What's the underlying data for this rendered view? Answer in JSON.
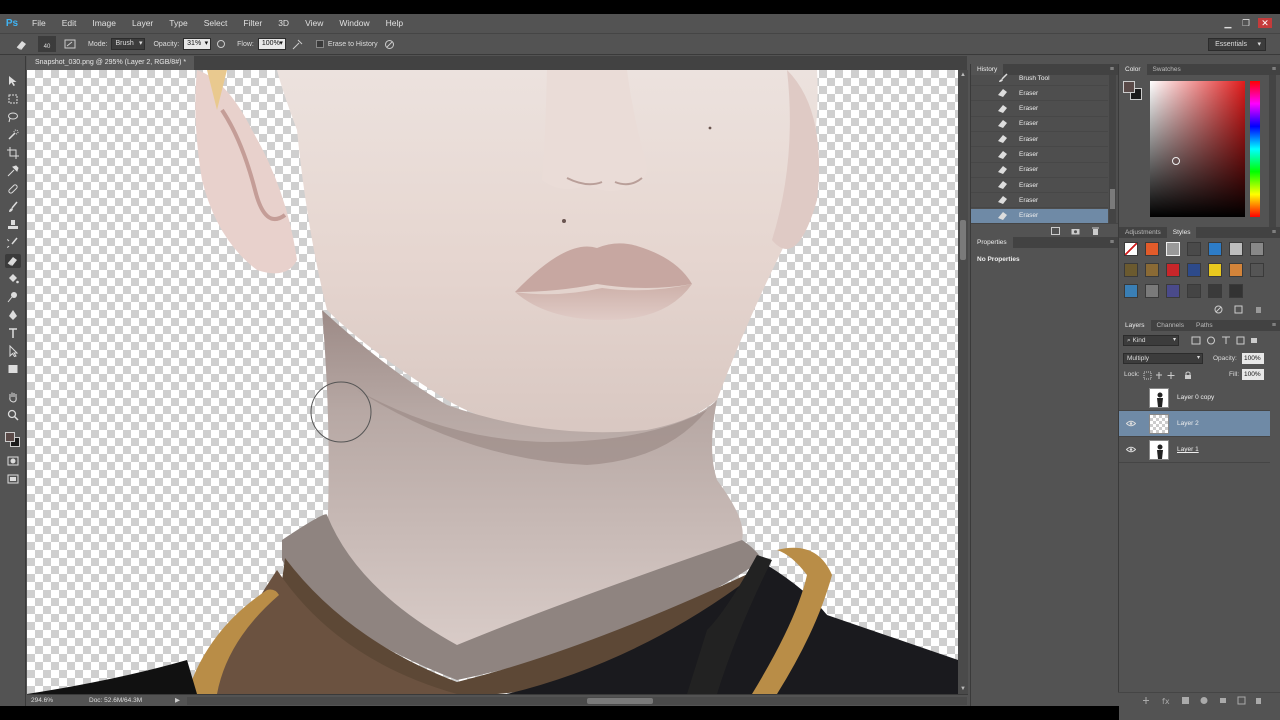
{
  "app": {
    "logo": "Ps",
    "menus": [
      "File",
      "Edit",
      "Image",
      "Layer",
      "Type",
      "Select",
      "Filter",
      "3D",
      "View",
      "Window",
      "Help"
    ],
    "window_buttons": [
      "minimize",
      "restore",
      "close"
    ]
  },
  "options_bar": {
    "brush_size": "40",
    "mode_label": "Mode:",
    "mode_value": "Brush",
    "opacity_label": "Opacity:",
    "opacity_value": "31%",
    "flow_label": "Flow:",
    "flow_value": "100%",
    "erase_to_history_label": "Erase to History",
    "erase_to_history_checked": false,
    "workspace": "Essentials"
  },
  "document": {
    "tab_title": "Snapshot_030.png @ 295% (Layer 2, RGB/8#) *",
    "zoom": "294.6%",
    "doc_size": "Doc: 52.6M/64.3M"
  },
  "history_panel": {
    "tab": "History",
    "items": [
      {
        "label": "Brush Tool",
        "icon": "brush-icon",
        "selected": false
      },
      {
        "label": "Eraser",
        "icon": "eraser-icon",
        "selected": false
      },
      {
        "label": "Eraser",
        "icon": "eraser-icon",
        "selected": false
      },
      {
        "label": "Eraser",
        "icon": "eraser-icon",
        "selected": false
      },
      {
        "label": "Eraser",
        "icon": "eraser-icon",
        "selected": false
      },
      {
        "label": "Eraser",
        "icon": "eraser-icon",
        "selected": false
      },
      {
        "label": "Eraser",
        "icon": "eraser-icon",
        "selected": false
      },
      {
        "label": "Eraser",
        "icon": "eraser-icon",
        "selected": false
      },
      {
        "label": "Eraser",
        "icon": "eraser-icon",
        "selected": false
      },
      {
        "label": "Eraser",
        "icon": "eraser-icon",
        "selected": true
      }
    ]
  },
  "properties_panel": {
    "tab": "Properties",
    "message": "No Properties"
  },
  "color_panel": {
    "tabs": [
      "Color",
      "Swatches"
    ],
    "active_tab": "Color",
    "foreground": "#5a4a48",
    "background": "#1a1a1a"
  },
  "styles_panel": {
    "tabs": [
      "Adjustments",
      "Styles"
    ],
    "active_tab": "Styles",
    "swatches": [
      "#ffffff",
      "#e25b2a",
      "#9a9a9a",
      "#4a4a4a",
      "#2d7cc7",
      "#bdbdbd",
      "#888888",
      "#6b5a2f",
      "#8a6a35",
      "#c8262a",
      "#2d4a8a",
      "#e8c81e",
      "#d3843a",
      "#555555",
      "#3a7fb5",
      "#7a7a7a",
      "#4a4a8a",
      "#444444",
      "#3a3a3a",
      "#333333"
    ]
  },
  "layers_panel": {
    "tabs": [
      "Layers",
      "Channels",
      "Paths"
    ],
    "active_tab": "Layers",
    "filter_kind": "Kind",
    "blend_mode": "Multiply",
    "opacity_label": "Opacity:",
    "opacity_value": "100%",
    "lock_label": "Lock:",
    "fill_label": "Fill:",
    "fill_value": "100%",
    "layers": [
      {
        "name": "Layer 0 copy",
        "visible": false,
        "selected": false,
        "thumb": "figure"
      },
      {
        "name": "Layer 2",
        "visible": true,
        "selected": true,
        "thumb": "transparent"
      },
      {
        "name": "Layer 1",
        "visible": true,
        "selected": false,
        "thumb": "figure"
      }
    ]
  }
}
